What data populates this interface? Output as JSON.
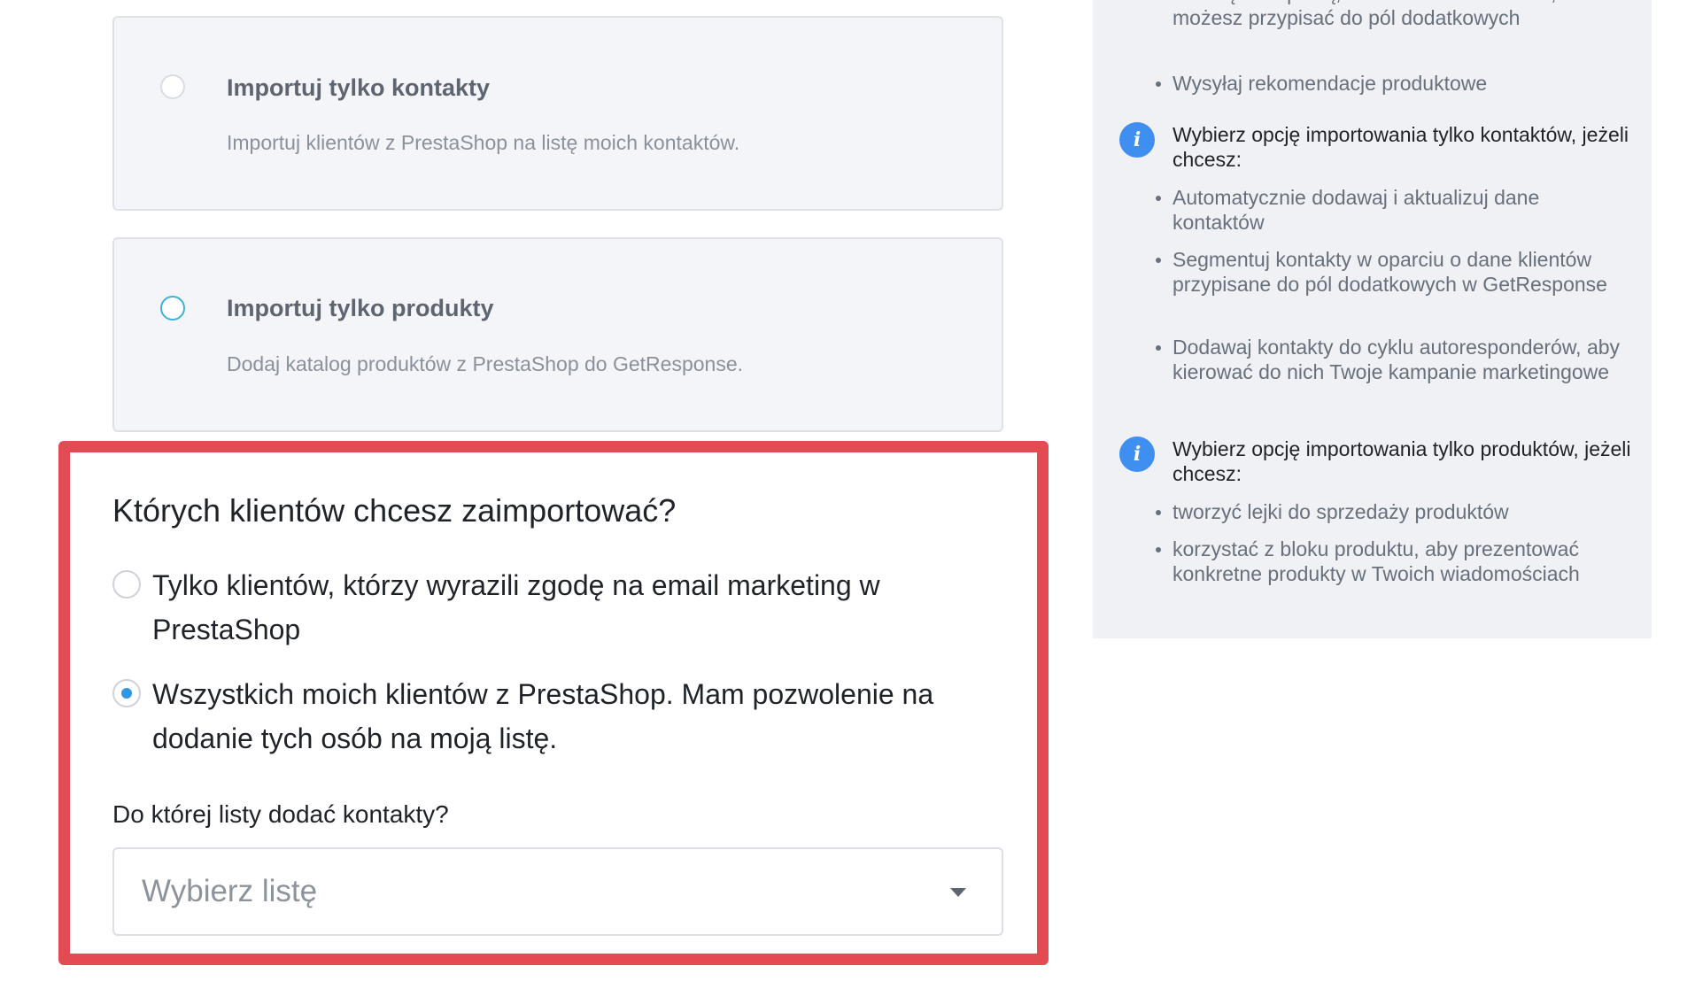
{
  "import_options": {
    "contacts_only": {
      "title": "Importuj tylko kontakty",
      "description": "Importuj klientów z PrestaShop na listę moich kontaktów."
    },
    "products_only": {
      "title": "Importuj tylko produkty",
      "description": "Dodaj katalog produktów z PrestaShop do GetResponse."
    }
  },
  "customers_section": {
    "heading": "Których klientów chcesz zaimportować?",
    "options": [
      {
        "label": "Tylko klientów, którzy wyrazili zgodę na email marketing w PrestaShop",
        "selected": false
      },
      {
        "label": "Wszystkich moich klientów z PrestaShop. Mam pozwolenie na dodanie tych osób na moją listę.",
        "selected": true
      }
    ],
    "list_label": "Do której listy dodać kontakty?",
    "list_select": {
      "placeholder": "Wybierz listę"
    }
  },
  "info_panel": {
    "top_items": [
      "historię zakupową, a także dane osobowe, które możesz przypisać do pól dodatkowych",
      "Wysyłaj rekomendacje produktowe"
    ],
    "contacts_tip": {
      "icon": "info-icon",
      "heading": "Wybierz opcję importowania tylko kontaktów, jeżeli chcesz:",
      "items": [
        "Automatycznie dodawaj i aktualizuj dane kontaktów",
        "Segmentuj kontakty w oparciu o dane klientów przypisane do pól dodatkowych w GetResponse",
        "Dodawaj kontakty do cyklu autoresponderów, aby kierować do nich Twoje kampanie marketingowe"
      ]
    },
    "products_tip": {
      "icon": "info-icon",
      "heading": "Wybierz opcję importowania tylko produktów, jeżeli chcesz:",
      "items": [
        "tworzyć lejki do sprzedaży produktów",
        "korzystać z bloku produktu, aby prezentować konkretne produkty w Twoich wiadomościach"
      ]
    }
  },
  "colors": {
    "highlight_border": "#e34a51",
    "radio_selected": "#2f97e6",
    "info_icon": "#3f8ff0",
    "panel_bg": "#f0f1f5"
  }
}
